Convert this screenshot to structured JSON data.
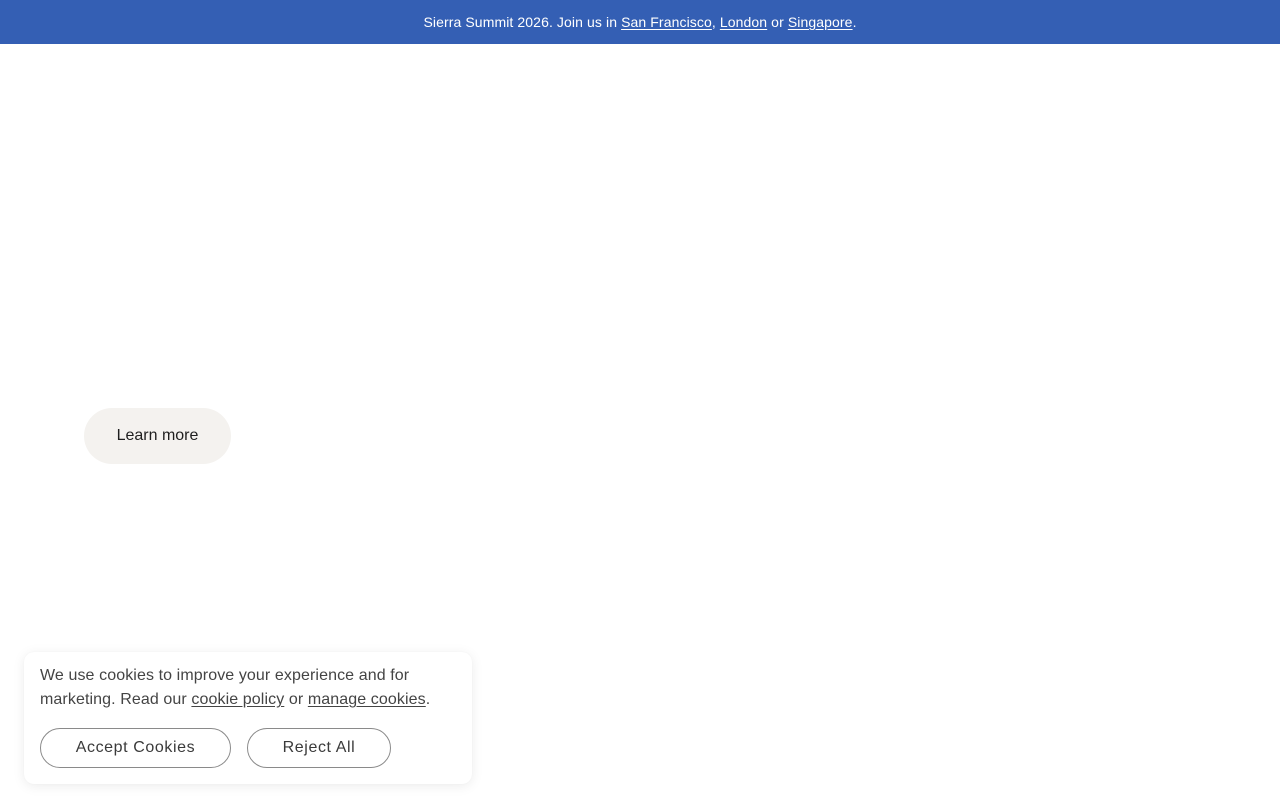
{
  "announcement": {
    "prefix": "Sierra Summit 2026. Join us in ",
    "link_sf": "San Francisco",
    "sep1": ", ",
    "link_london": "London",
    "sep2": " or ",
    "link_singapore": "Singapore",
    "suffix": "."
  },
  "hero": {
    "learn_more_label": "Learn more"
  },
  "cookie_banner": {
    "text_part1": "We use cookies to improve your experience and for marketing. Read our ",
    "cookie_policy_link": "cookie policy",
    "text_part2": " or ",
    "manage_cookies_link": "manage cookies",
    "text_part3": ".",
    "accept_label": "Accept Cookies",
    "reject_label": "Reject All"
  },
  "colors": {
    "announcement_bg": "#345fb4",
    "button_bg": "#f4f2ef"
  }
}
